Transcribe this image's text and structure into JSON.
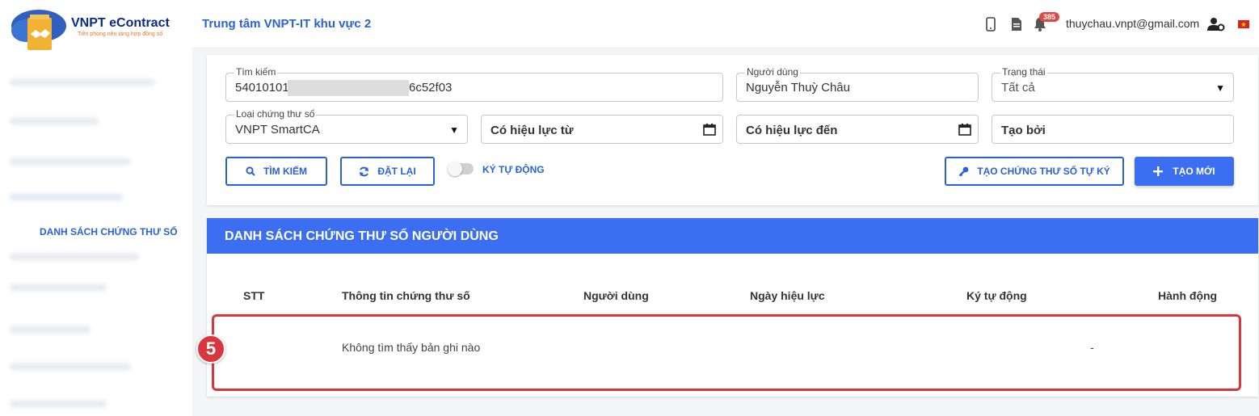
{
  "brand": {
    "name": "VNPT eContract",
    "slogan": "Tiên phong nền tảng hợp đồng số"
  },
  "sidebar": {
    "active_item": "DANH SÁCH CHỨNG THƯ SỐ"
  },
  "header": {
    "org_name": "Trung tâm VNPT-IT khu vực 2",
    "notification_count": "385",
    "user_email": "thuychau.vnpt@gmail.com"
  },
  "filters": {
    "search": {
      "label": "Tìm kiếm",
      "value_start": "54010101",
      "value_end": "6c52f03"
    },
    "user": {
      "label": "Người dùng",
      "value": "Nguyễn Thuỳ Châu"
    },
    "status": {
      "label": "Trạng thái",
      "value": "Tất cả"
    },
    "cert_type": {
      "label": "Loại chứng thư số",
      "value": "VNPT SmartCA"
    },
    "valid_from": {
      "placeholder": "Có hiệu lực từ"
    },
    "valid_to": {
      "placeholder": "Có hiệu lực đến"
    },
    "created_by": {
      "placeholder": "Tạo bởi"
    }
  },
  "actions": {
    "search": "TÌM KIẾM",
    "reset": "ĐẶT LẠI",
    "auto_sign_toggle": "KÝ TỰ ĐỘNG",
    "create_self_signed": "TẠO CHỨNG THƯ SỐ TỰ KÝ",
    "create_new": "TẠO MỚI"
  },
  "table": {
    "title": "DANH SÁCH CHỨNG THƯ SỐ NGƯỜI DÙNG",
    "columns": [
      "STT",
      "Thông tin chứng thư số",
      "Người dùng",
      "Ngày hiệu lực",
      "Ký tự động",
      "Hành động"
    ],
    "empty_message": "Không tìm thấy bản ghi nào",
    "auto_sign_value": "-"
  },
  "annotation": {
    "step_number": "5"
  },
  "colors": {
    "primary": "#3b6ef0",
    "link": "#2a62d6",
    "highlight": "#d9373f",
    "badge": "#e04848"
  },
  "icons": [
    "mobile-icon",
    "document-icon",
    "bell-icon",
    "user-settings-icon",
    "vietnam-flag-icon",
    "search-icon",
    "refresh-icon",
    "key-icon",
    "plus-icon",
    "calendar-icon"
  ]
}
